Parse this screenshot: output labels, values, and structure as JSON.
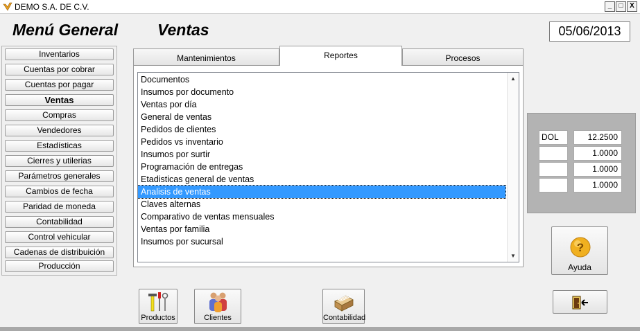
{
  "window": {
    "title": "DEMO  S.A. DE C.V.",
    "min": "_",
    "max": "□",
    "close": "X"
  },
  "header": {
    "menu_title": "Menú General",
    "section_title": "Ventas",
    "date": "05/06/2013"
  },
  "sidebar": {
    "items": [
      {
        "label": "Inventarios"
      },
      {
        "label": "Cuentas por cobrar"
      },
      {
        "label": "Cuentas por pagar"
      },
      {
        "label": "Ventas",
        "active": true
      },
      {
        "label": "Compras"
      },
      {
        "label": "Vendedores"
      },
      {
        "label": "Estadísticas"
      },
      {
        "label": "Cierres y utilerias"
      },
      {
        "label": "Parámetros generales"
      },
      {
        "label": "Cambios de fecha"
      },
      {
        "label": "Paridad de moneda"
      },
      {
        "label": "Contabilidad"
      },
      {
        "label": "Control vehicular"
      },
      {
        "label": "Cadenas de distribuición"
      },
      {
        "label": "Producción"
      }
    ]
  },
  "tabs": [
    {
      "label": "Mantenimientos"
    },
    {
      "label": "Reportes",
      "active": true
    },
    {
      "label": "Procesos"
    }
  ],
  "reports": {
    "items": [
      "Documentos",
      "Insumos por documento",
      "Ventas por día",
      "General de ventas",
      "Pedidos de clientes",
      "Pedidos vs inventario",
      "Insumos por surtir",
      "Programación de entregas",
      "Etadisticas  general de ventas",
      "Analisis de ventas",
      "Claves alternas",
      "Comparativo de ventas mensuales",
      "Ventas por familia",
      "Insumos por sucursal"
    ],
    "selected": "Analisis de ventas"
  },
  "currencies": [
    {
      "code": "DOL",
      "rate": "12.2500"
    },
    {
      "code": "",
      "rate": "1.0000"
    },
    {
      "code": "",
      "rate": "1.0000"
    },
    {
      "code": "",
      "rate": "1.0000"
    }
  ],
  "buttons": {
    "productos": "Productos",
    "clientes": "Clientes",
    "contabilidad": "Contabilidad",
    "ayuda": "Ayuda",
    "ayuda_icon": "?"
  },
  "colors": {
    "selection": "#3399ff",
    "panel_gray": "#b3b3b3",
    "help_icon": "#f0b020"
  }
}
